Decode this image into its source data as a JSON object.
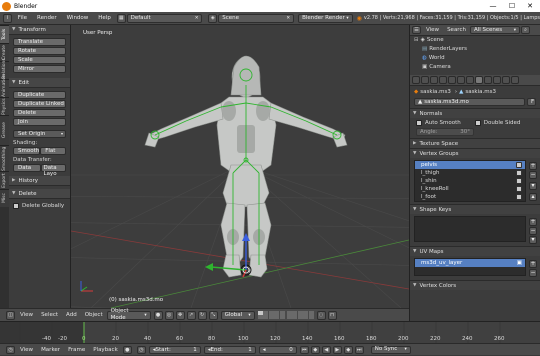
{
  "window": {
    "title": "Blender",
    "minimize": "—",
    "maximize": "☐",
    "close": "✕"
  },
  "topbar": {
    "menus": [
      "File",
      "Render",
      "Window",
      "Help"
    ],
    "layout": "Default",
    "scene": "Scene",
    "engine": "Blender Render",
    "stats": "v2.78 | Verts:21,968 | Faces:31,159 | Tris:31,159 | Objects:1/5 | Lamps"
  },
  "left_tabs": [
    "Tools",
    "Create",
    "Relations",
    "Animation",
    "Physics",
    "Grease Pencil",
    "Smoothing",
    "Export",
    "Misc"
  ],
  "toolshelf": {
    "transform_header": "Transform",
    "transform_buttons": [
      "Translate",
      "Rotate",
      "Scale",
      "Mirror"
    ],
    "edit_header": "Edit",
    "edit_buttons": [
      "Duplicate",
      "Duplicate Linked",
      "Delete",
      "Join"
    ],
    "set_origin": "Set Origin",
    "shading_label": "Shading:",
    "smooth": "Smooth",
    "flat": "Flat",
    "data_transfer_label": "Data Transfer:",
    "data": "Data",
    "data_layo": "Data Layo",
    "history_header": "History",
    "delete_header": "Delete",
    "delete_globally": "Delete Globally"
  },
  "viewport": {
    "view_label": "User Persp",
    "object_label": "(0) saskia.ms3d.mo"
  },
  "view3d_header": {
    "menus": [
      "View",
      "Select",
      "Add",
      "Object"
    ],
    "mode": "Object Mode",
    "orientation": "Global"
  },
  "timeline": {
    "ticks": [
      "-40",
      "-20",
      "0",
      "20",
      "40",
      "60",
      "80",
      "100",
      "120",
      "140",
      "160",
      "180",
      "200",
      "220",
      "240",
      "260"
    ],
    "menus": [
      "View",
      "Marker",
      "Frame",
      "Playback"
    ],
    "start_label": "Start:",
    "start_value": "1",
    "end_label": "End:",
    "end_value": "1",
    "current_frame": "0",
    "sync": "No Sync"
  },
  "outliner": {
    "view": "View",
    "search": "Search",
    "filter": "All Scenes",
    "items": [
      "Scene",
      "RenderLayers",
      "World",
      "Camera"
    ]
  },
  "properties": {
    "breadcrumb_object": "saskia.ms3",
    "breadcrumb_mesh": "saskia.ms3",
    "mesh_name": "saskia.ms3d.mo",
    "fake_user": "F",
    "normals_header": "Normals",
    "auto_smooth": "Auto Smooth",
    "double_sided": "Double Sided",
    "angle_label": "Angle:",
    "angle_value": "30°",
    "texture_space_header": "Texture Space",
    "vertex_groups_header": "Vertex Groups",
    "vertex_groups": [
      "pelvis",
      "l_thigh",
      "l_shin",
      "l_kneeRoll",
      "l_foot"
    ],
    "shape_keys_header": "Shape Keys",
    "uv_maps_header": "UV Maps",
    "uv_layer": "ms3d_uv_layer",
    "vertex_colors_header": "Vertex Colors"
  },
  "colors": {
    "selection_blue": "#5680c2",
    "armature_green": "#2fb52f",
    "blender_orange": "#e87d0d"
  }
}
